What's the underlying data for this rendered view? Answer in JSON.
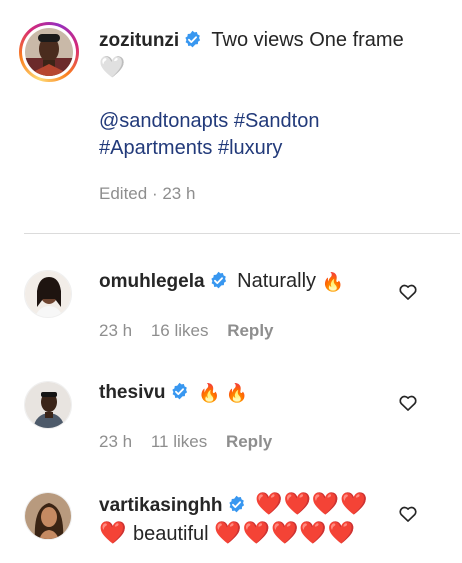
{
  "caption": {
    "username": "zozitunzi",
    "text": "Two views One frame",
    "heart_emoji": "🤍",
    "tags_line1": "@sandtonapts #Sandton",
    "tags_line2": "#Apartments #luxury",
    "edited": "Edited",
    "separator": "·",
    "time": "23 h"
  },
  "comments": [
    {
      "username": "omuhlegela",
      "text": "Naturally",
      "emoji": "🔥",
      "time": "23 h",
      "likes": "16 likes",
      "reply_label": "Reply"
    },
    {
      "username": "thesivu",
      "emoji": "🔥 🔥",
      "time": "23 h",
      "likes": "11 likes",
      "reply_label": "Reply"
    },
    {
      "username": "vartikasinghh",
      "hearts_line1": "❤️❤️❤️❤️",
      "hearts_prefix": "❤️",
      "text": "beautiful",
      "hearts_suffix": "❤️❤️❤️❤️❤️"
    }
  ],
  "icons": {
    "verified": "verified-badge-icon",
    "like": "heart-outline-icon"
  },
  "colors": {
    "verified_blue": "#3897f0",
    "link_blue": "#223a7a",
    "muted_gray": "#8e8e8e",
    "heart_red": "#dd1f2c"
  }
}
